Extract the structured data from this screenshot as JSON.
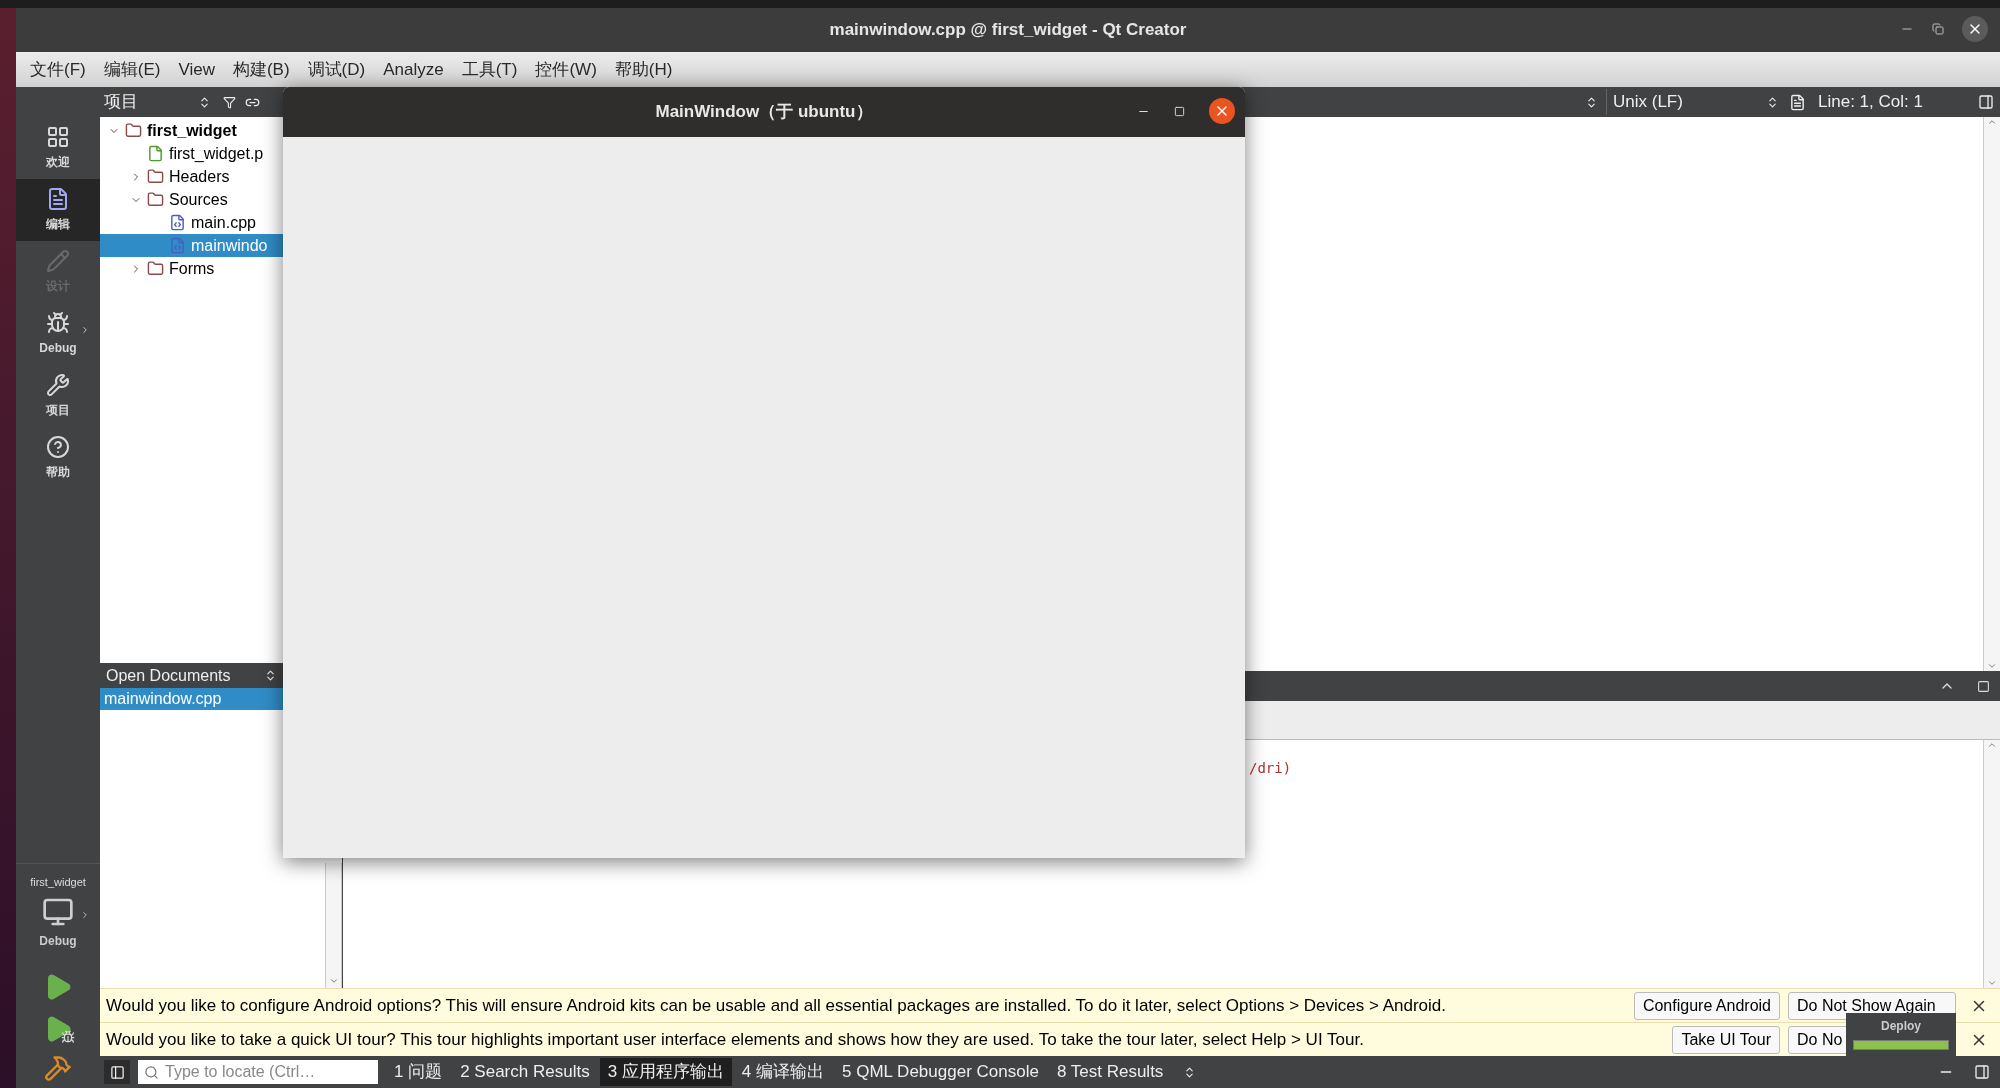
{
  "window": {
    "title": "mainwindow.cpp @ first_widget - Qt Creator"
  },
  "menu": [
    "文件(F)",
    "编辑(E)",
    "View",
    "构建(B)",
    "调试(D)",
    "Analyze",
    "工具(T)",
    "控件(W)",
    "帮助(H)"
  ],
  "modes": [
    {
      "label": "欢迎",
      "kind": "welcome",
      "selected": false,
      "disabled": false
    },
    {
      "label": "编辑",
      "kind": "edit",
      "selected": true,
      "disabled": false
    },
    {
      "label": "设计",
      "kind": "design",
      "selected": false,
      "disabled": true
    },
    {
      "label": "Debug",
      "kind": "debug",
      "selected": false,
      "disabled": false
    },
    {
      "label": "项目",
      "kind": "projects",
      "selected": false,
      "disabled": false
    },
    {
      "label": "帮助",
      "kind": "help",
      "selected": false,
      "disabled": false
    }
  ],
  "target": {
    "project": "first_widget",
    "config": "Debug"
  },
  "projects": {
    "title": "项目",
    "tree": [
      {
        "label": "first_widget",
        "kind": "project",
        "expanded": true,
        "selected": false,
        "children": [
          {
            "label": "first_widget.p",
            "kind": "profile",
            "selected": false
          },
          {
            "label": "Headers",
            "kind": "headers",
            "expanded": false,
            "selected": false
          },
          {
            "label": "Sources",
            "kind": "sources",
            "expanded": true,
            "selected": false,
            "children": [
              {
                "label": "main.cpp",
                "kind": "cpp",
                "selected": false
              },
              {
                "label": "mainwindo",
                "kind": "cpp",
                "selected": true
              }
            ]
          },
          {
            "label": "Forms",
            "kind": "forms",
            "expanded": false,
            "selected": false
          }
        ]
      }
    ]
  },
  "open_documents": {
    "title": "Open Documents",
    "items": [
      {
        "label": "mainwindow.cpp",
        "selected": true
      }
    ]
  },
  "editor": {
    "line_ending": "Unix (LF)",
    "position": "Line: 1, Col: 1"
  },
  "output": {
    "lines": [
      "/dri)"
    ]
  },
  "info_bars": [
    {
      "text": "Would you like to configure Android options? This will ensure Android kits can be usable and all essential packages are installed. To do it later, select Options > Devices > Android.",
      "buttons": [
        "Configure Android",
        "Do Not Show Again"
      ]
    },
    {
      "text": "Would you like to take a quick UI tour? This tour highlights important user interface elements and shows how they are used. To take the tour later, select Help > UI Tour.",
      "buttons": [
        "Take UI Tour",
        "Do No"
      ]
    }
  ],
  "status_bar": {
    "locator": {
      "placeholder": "Type to locate (Ctrl…"
    },
    "tabs": [
      {
        "label": "1 问题",
        "selected": false
      },
      {
        "label": "2 Search Results",
        "selected": false
      },
      {
        "label": "3 应用程序输出",
        "selected": true
      },
      {
        "label": "4 编译输出",
        "selected": false
      },
      {
        "label": "5 QML Debugger Console",
        "selected": false
      },
      {
        "label": "8 Test Results",
        "selected": false
      }
    ]
  },
  "deploy": {
    "label": "Deploy",
    "level": 1
  },
  "dialog": {
    "title": "MainWindow（于 ubuntu）"
  }
}
